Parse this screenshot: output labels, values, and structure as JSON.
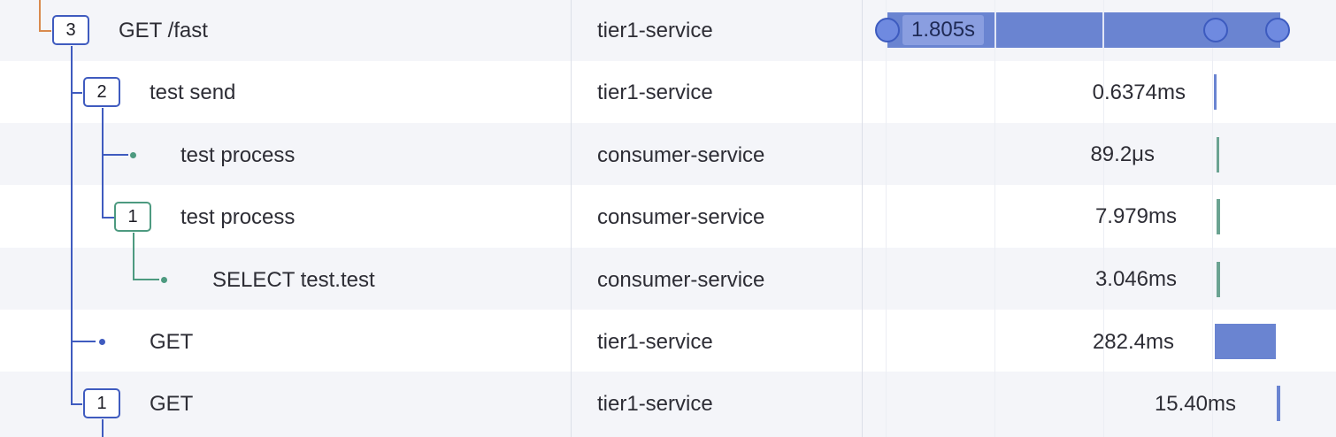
{
  "trace": {
    "rows": [
      {
        "badge": "3",
        "name": "GET /fast",
        "service": "tier1-service",
        "duration": "1.805s"
      },
      {
        "badge": "2",
        "name": "test send",
        "service": "tier1-service",
        "duration": "0.6374ms"
      },
      {
        "badge": "",
        "name": "test process",
        "service": "consumer-service",
        "duration": "89.2μs"
      },
      {
        "badge": "1",
        "name": "test process",
        "service": "consumer-service",
        "duration": "7.979ms"
      },
      {
        "badge": "",
        "name": "SELECT test.test",
        "service": "consumer-service",
        "duration": "3.046ms"
      },
      {
        "badge": "",
        "name": "GET",
        "service": "tier1-service",
        "duration": "282.4ms"
      },
      {
        "badge": "1",
        "name": "GET",
        "service": "tier1-service",
        "duration": "15.40ms"
      }
    ]
  },
  "colors": {
    "tier1_service": "#6a84d1",
    "consumer_service": "#6ba392",
    "tree_line_blue": "#3f5bbf",
    "tree_line_green": "#4d9a80",
    "tree_line_orange": "#d98a4e"
  }
}
